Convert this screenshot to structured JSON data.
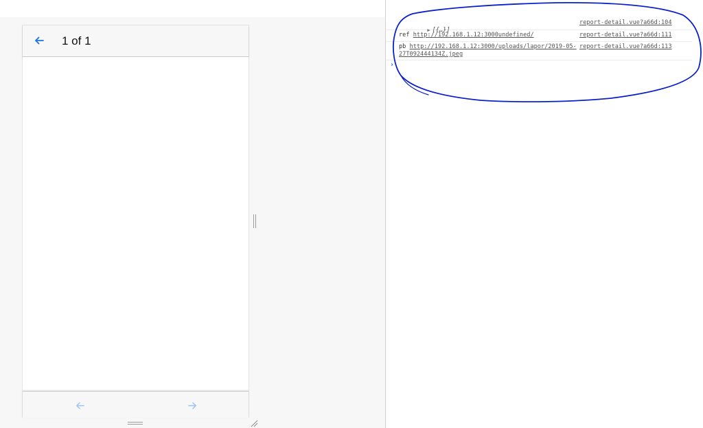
{
  "app": {
    "page_indicator": "1 of 1",
    "back_icon": "arrow-left-icon",
    "prev_icon": "arrow-left-icon",
    "next_icon": "arrow-right-icon",
    "accent_color": "#1a73e8",
    "nav_disabled_color": "#9cc3f5"
  },
  "console": {
    "logs": [
      {
        "object_preview": "[{…}]",
        "source": "report-detail.vue?a66d:104"
      },
      {
        "label": "ref",
        "url": "http://192.168.1.12:3000undefined/",
        "source": "report-detail.vue?a66d:111"
      },
      {
        "label": "pb",
        "url": "http://192.168.1.12:3000/uploads/lapor/2019-05-27T092444134Z.jpeg",
        "source": "report-detail.vue?a66d:113"
      }
    ],
    "prompt_symbol": "›"
  },
  "annotation_color": "#0a1fcc"
}
